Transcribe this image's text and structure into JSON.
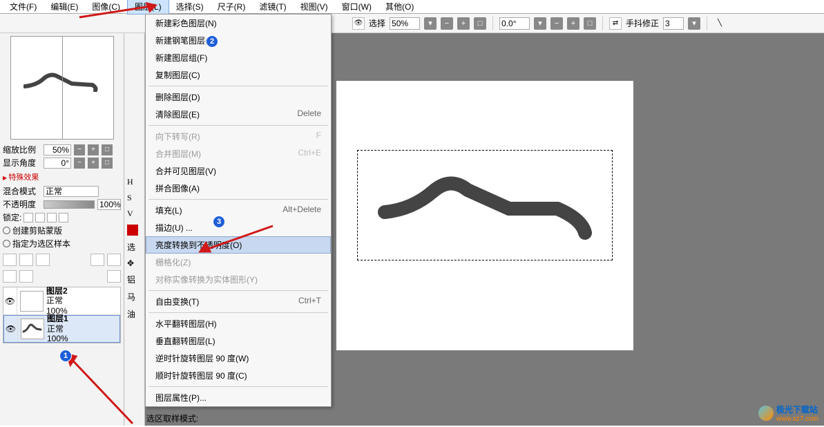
{
  "menubar": {
    "items": [
      "文件(F)",
      "编辑(E)",
      "图像(C)",
      "图层(L)",
      "选择(S)",
      "尺子(R)",
      "滤镜(T)",
      "视图(V)",
      "窗口(W)",
      "其他(O)"
    ]
  },
  "toolbar": {
    "select_label": "选择",
    "select_value": "50%",
    "rotate_value": "0.0°",
    "stabilizer_label": "手抖修正",
    "stabilizer_value": "3"
  },
  "left": {
    "zoom_label": "缩放比例",
    "zoom_value": "50%",
    "angle_label": "显示角度",
    "angle_value": "0°",
    "effects_label": "特殊效果",
    "blend_label": "混合模式",
    "blend_value": "正常",
    "opacity_label": "不透明度",
    "opacity_value": "100%",
    "lock_label": "锁定:",
    "clip_label": "创建剪贴蒙版",
    "sel_label": "指定为选区样本",
    "layers": [
      {
        "name": "图层2",
        "mode": "正常",
        "opacity": "100%"
      },
      {
        "name": "图层1",
        "mode": "正常",
        "opacity": "100%"
      }
    ]
  },
  "mid_chars": [
    "H",
    "S",
    "V",
    "选",
    "铝",
    "马",
    "油"
  ],
  "dropdown": {
    "items": [
      {
        "label": "新建彩色图层(N)",
        "shortcut": "",
        "disabled": false
      },
      {
        "label": "新建钢笔图层(I)",
        "shortcut": "",
        "disabled": false
      },
      {
        "label": "新建图层组(F)",
        "shortcut": "",
        "disabled": false
      },
      {
        "label": "复制图层(C)",
        "shortcut": "",
        "disabled": false
      },
      {
        "sep": true
      },
      {
        "label": "删除图层(D)",
        "shortcut": "",
        "disabled": false
      },
      {
        "label": "清除图层(E)",
        "shortcut": "Delete",
        "disabled": false
      },
      {
        "sep": true
      },
      {
        "label": "向下转写(R)",
        "shortcut": "F",
        "disabled": true
      },
      {
        "label": "合并图层(M)",
        "shortcut": "Ctrl+E",
        "disabled": true
      },
      {
        "label": "合并可见图层(V)",
        "shortcut": "",
        "disabled": false
      },
      {
        "label": "拼合图像(A)",
        "shortcut": "",
        "disabled": false
      },
      {
        "sep": true
      },
      {
        "label": "填充(L)",
        "shortcut": "Alt+Delete",
        "disabled": false
      },
      {
        "label": "描边(U) ...",
        "shortcut": "",
        "disabled": false
      },
      {
        "label": "亮度转换到不透明度(O)",
        "shortcut": "",
        "disabled": false,
        "highlighted": true
      },
      {
        "label": "栅格化(Z)",
        "shortcut": "",
        "disabled": true
      },
      {
        "label": "对称实像转换为实体图形(Y)",
        "shortcut": "",
        "disabled": true
      },
      {
        "sep": true
      },
      {
        "label": "自由变换(T)",
        "shortcut": "Ctrl+T",
        "disabled": false
      },
      {
        "sep": true
      },
      {
        "label": "水平翻转图层(H)",
        "shortcut": "",
        "disabled": false
      },
      {
        "label": "垂直翻转图层(L)",
        "shortcut": "",
        "disabled": false
      },
      {
        "label": "逆时针旋转图层 90 度(W)",
        "shortcut": "",
        "disabled": false
      },
      {
        "label": "顺时针旋转图层 90 度(C)",
        "shortcut": "",
        "disabled": false
      },
      {
        "sep": true
      },
      {
        "label": "图层属性(P)...",
        "shortcut": "",
        "disabled": false
      }
    ]
  },
  "annotations": {
    "n1": "1",
    "n2": "2",
    "n3": "3"
  },
  "bottom": {
    "label": "选区取样模式:"
  },
  "watermark": {
    "name": "极光下载站",
    "url": "www.xz7.com"
  }
}
